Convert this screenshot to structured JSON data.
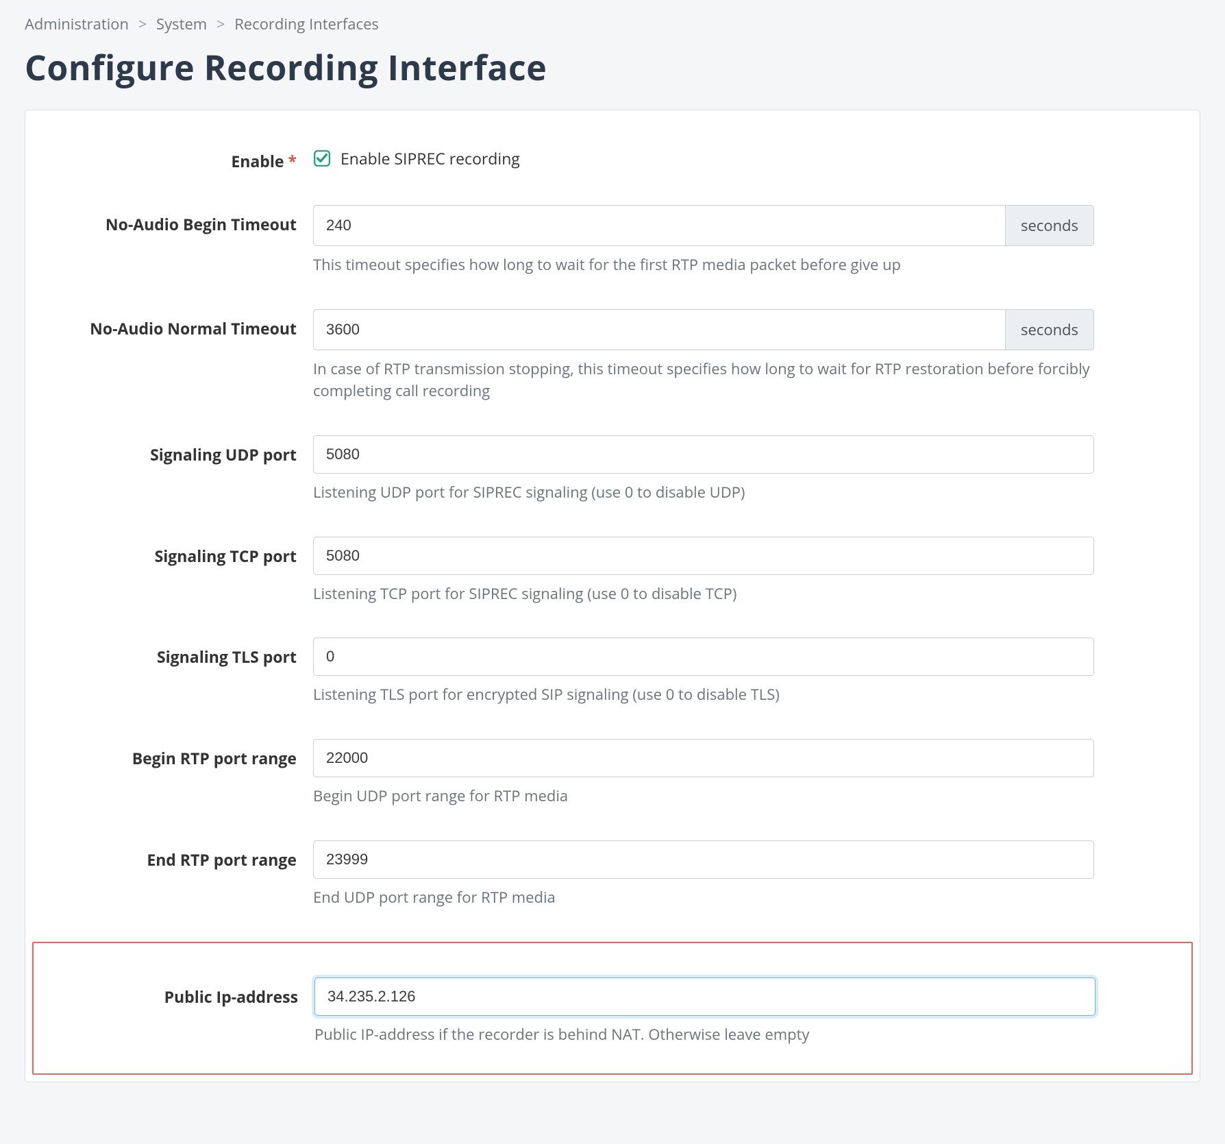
{
  "breadcrumb": {
    "items": [
      "Administration",
      "System",
      "Recording Interfaces"
    ]
  },
  "title": "Configure Recording Interface",
  "form": {
    "enable": {
      "label": "Enable",
      "required_mark": "*",
      "checkbox_label": "Enable SIPREC recording",
      "checked": true
    },
    "no_audio_begin": {
      "label": "No-Audio Begin Timeout",
      "value": "240",
      "addon": "seconds",
      "help": "This timeout specifies how long to wait for the first RTP media packet before give up"
    },
    "no_audio_normal": {
      "label": "No-Audio Normal Timeout",
      "value": "3600",
      "addon": "seconds",
      "help": "In case of RTP transmission stopping, this timeout specifies how long to wait for RTP restoration before forcibly completing call recording"
    },
    "udp_port": {
      "label": "Signaling UDP port",
      "value": "5080",
      "help": "Listening UDP port for SIPREC signaling (use 0 to disable UDP)"
    },
    "tcp_port": {
      "label": "Signaling TCP port",
      "value": "5080",
      "help": "Listening TCP port for SIPREC signaling (use 0 to disable TCP)"
    },
    "tls_port": {
      "label": "Signaling TLS port",
      "value": "0",
      "help": "Listening TLS port for encrypted SIP signaling (use 0 to disable TLS)"
    },
    "rtp_begin": {
      "label": "Begin RTP port range",
      "value": "22000",
      "help": "Begin UDP port range for RTP media"
    },
    "rtp_end": {
      "label": "End RTP port range",
      "value": "23999",
      "help": "End UDP port range for RTP media"
    },
    "public_ip": {
      "label": "Public Ip-address",
      "value": "34.235.2.126",
      "help": "Public IP-address if the recorder is behind NAT. Otherwise leave empty"
    }
  }
}
